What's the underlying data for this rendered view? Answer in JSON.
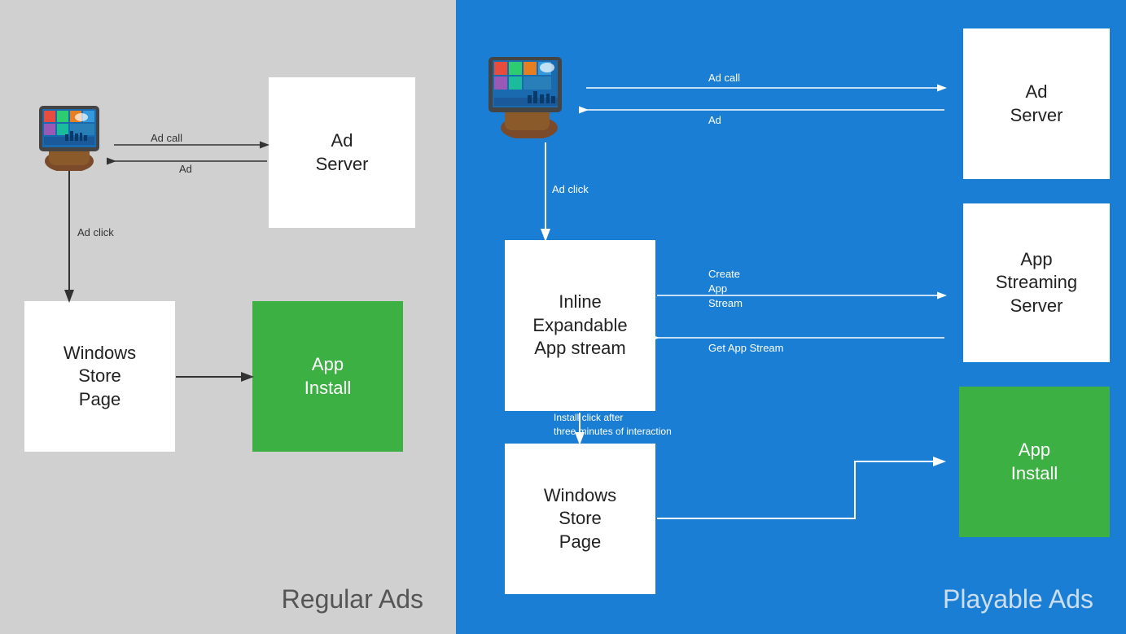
{
  "left": {
    "panel_label": "Regular Ads",
    "ad_server": "Ad\nServer",
    "windows_store": "Windows\nStore\nPage",
    "app_install": "App\nInstall",
    "ad_call_label": "Ad call",
    "ad_label": "Ad",
    "ad_click_label": "Ad click"
  },
  "right": {
    "panel_label": "Playable Ads",
    "ad_server": "Ad\nServer",
    "streaming_server": "App\nStreaming\nServer",
    "inline_expandable": "Inline\nExpandable\nApp stream",
    "windows_store": "Windows\nStore\nPage",
    "app_install": "App\nInstall",
    "ad_call_label": "Ad call",
    "ad_label": "Ad",
    "ad_click_label": "Ad click",
    "create_stream_label": "Create\nApp\nStream",
    "get_stream_label": "Get App Stream",
    "install_click_label": "Install click after\nthree minutes of interaction"
  }
}
